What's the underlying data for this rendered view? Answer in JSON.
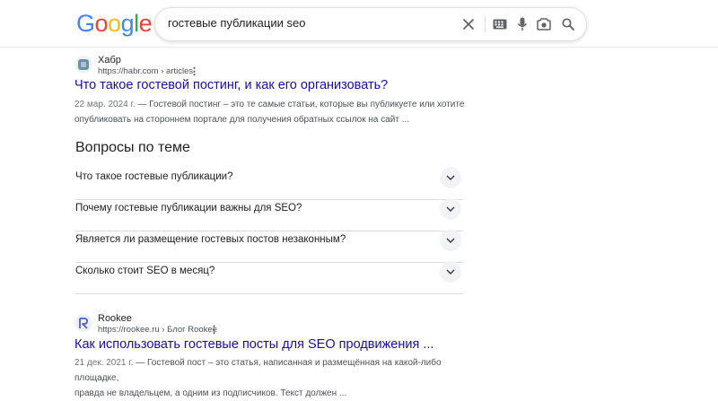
{
  "header": {
    "logo": {
      "letters": [
        "G",
        "o",
        "o",
        "g",
        "l",
        "e"
      ],
      "colors": [
        "#4285F4",
        "#EA4335",
        "#FBBC05",
        "#4285F4",
        "#34A853",
        "#EA4335"
      ]
    },
    "search": {
      "value": "гостевые публикации seo"
    },
    "icons": [
      "close-icon",
      "keyboard-icon",
      "microphone-icon",
      "lens-icon",
      "search-icon"
    ]
  },
  "results": [
    {
      "site_name": "Хабр",
      "url": "https://habr.com › articles",
      "title": "Что такое гостевой постинг, и как его организовать?",
      "date": "22 мар. 2024 г.",
      "snippet_line1": " — Гостевой постинг – это те самые статьи, которые вы публикуете или хотите",
      "snippet_line2": "опубликовать на стороннем портале для получения обратных ссылок на сайт ..."
    },
    {
      "site_name": "Rookee",
      "url": "https://rookee.ru › Блог Rookee",
      "title": "Как использовать гостевые посты для SEO продвижения ...",
      "date": "21 дек. 2021 г.",
      "snippet_line1": " — Гостевой пост – это статья, написанная и размещённая на какой-либо площадке,",
      "snippet_line2": "правда не владельцем, а одним из подписчиков. Текст должен ..."
    }
  ],
  "paa": {
    "title": "Вопросы по теме",
    "questions": [
      "Что такое гостевые публикации?",
      "Почему гостевые публикации важны для SEO?",
      "Является ли размещение гостевых постов незаконным?",
      "Сколько стоит SEO в месяц?"
    ]
  },
  "colors": {
    "link": "#1a0dab",
    "text": "#202124",
    "muted": "#4d5156"
  }
}
